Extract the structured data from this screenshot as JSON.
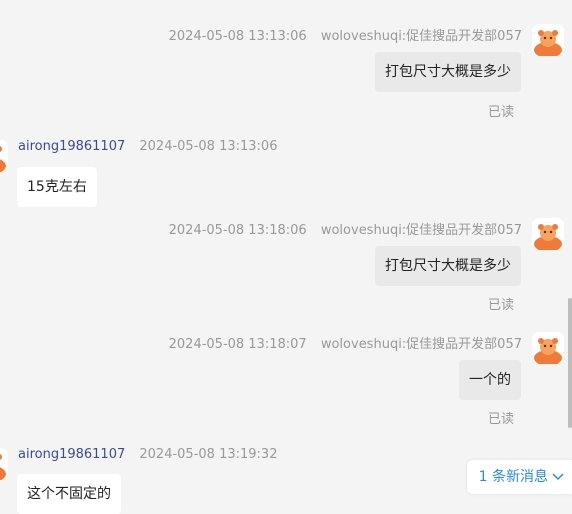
{
  "messages": [
    {
      "time": "2024-05-08 13:13:06",
      "sender": "woloveshuqi:促佳搜品开发部057",
      "text": "打包尺寸大概是多少",
      "status": "已读"
    },
    {
      "name": "airong19861107",
      "time": "2024-05-08 13:13:06",
      "text": "15克左右"
    },
    {
      "time": "2024-05-08 13:18:06",
      "sender": "woloveshuqi:促佳搜品开发部057",
      "text": "打包尺寸大概是多少",
      "status": "已读"
    },
    {
      "time": "2024-05-08 13:18:07",
      "sender": "woloveshuqi:促佳搜品开发部057",
      "text": "一个的",
      "status": "已读"
    },
    {
      "name": "airong19861107",
      "time": "2024-05-08 13:19:32",
      "text": "这个不固定的"
    }
  ],
  "new_messages": {
    "label": "1 条新消息",
    "icon": "chevron-down-icon"
  },
  "colors": {
    "link": "#2a8de0",
    "name": "#3b4a9c",
    "avatar": "#f07a3a"
  }
}
